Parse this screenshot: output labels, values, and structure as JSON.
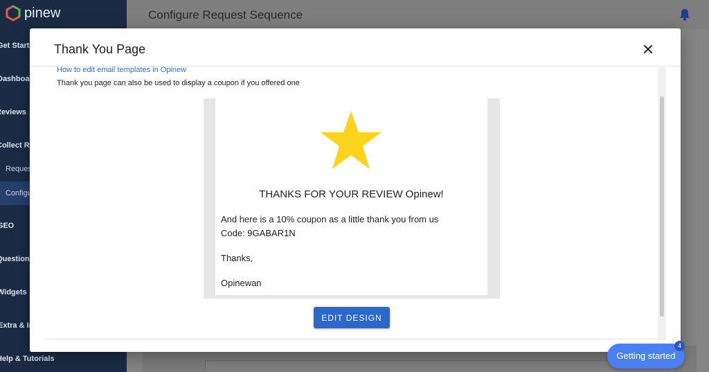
{
  "app": {
    "logo_text": "pinew",
    "page_title": "Configure Request Sequence"
  },
  "sidebar": {
    "items": [
      {
        "label": "Get Started"
      },
      {
        "label": "Dashboard"
      },
      {
        "label": "Reviews"
      },
      {
        "label": "Collect Reviews"
      },
      {
        "label": "Requests"
      },
      {
        "label": "Configure"
      },
      {
        "label": "SEO"
      },
      {
        "label": "Questions"
      },
      {
        "label": "Widgets"
      },
      {
        "label": "Extra & Integrations"
      },
      {
        "label": "Help & Tutorials"
      }
    ]
  },
  "modal": {
    "title": "Thank You Page",
    "help_link": "How to edit email templates in Opinew",
    "help_text": "Thank you page can also be used to display a coupon if you offered one",
    "preview": {
      "heading": "THANKS FOR YOUR REVIEW Opinew!",
      "coupon_line": "And here is a 10% coupon as a little thank you from us",
      "code_line": "Code: 9GABAR1N",
      "thanks_line": "Thanks,",
      "signature": "Opinewan",
      "star_color": "#fdd41d"
    },
    "edit_button": "EDIT DESIGN"
  },
  "widget": {
    "label": "Getting started",
    "badge_count": "4"
  },
  "colors": {
    "sidebar_bg": "#1b2b45",
    "accent": "#2d67c9",
    "widget": "#4c7ff0"
  }
}
